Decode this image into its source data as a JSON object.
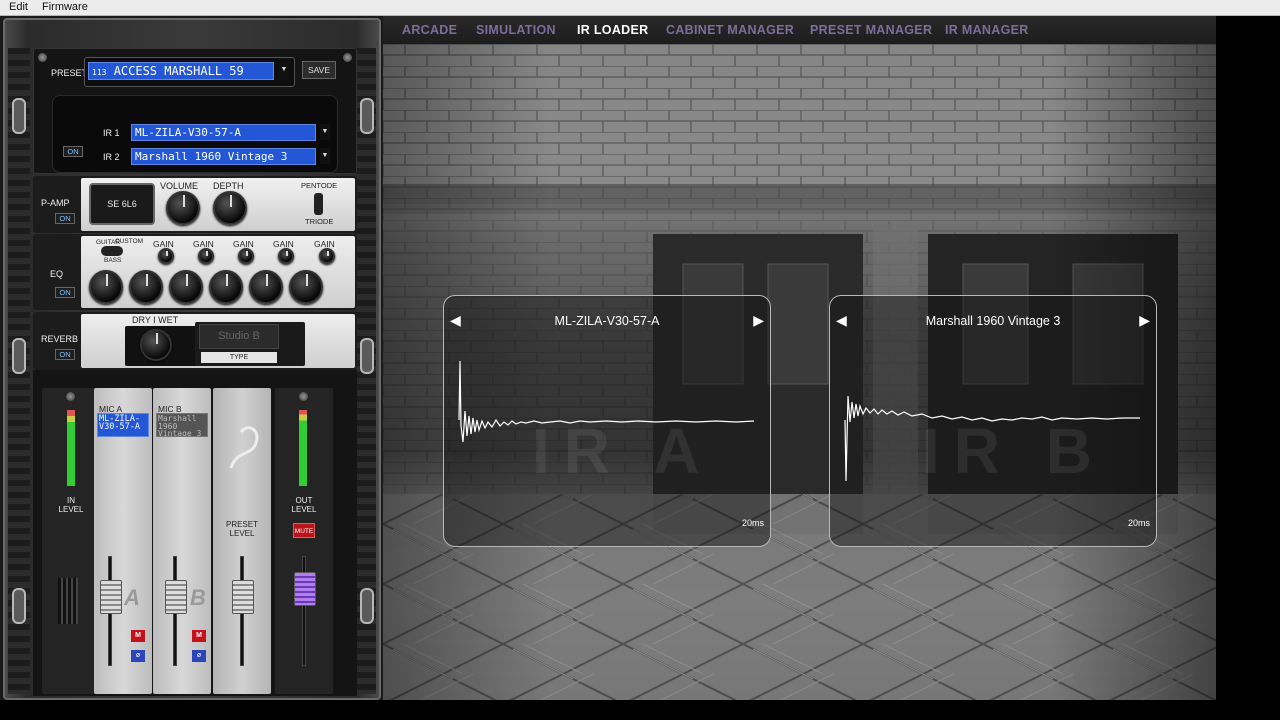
{
  "menubar": {
    "edit": "Edit",
    "firmware": "Firmware"
  },
  "tabs": [
    {
      "label": "ARCADE",
      "active": false
    },
    {
      "label": "SIMULATION",
      "active": false
    },
    {
      "label": "IR LOADER",
      "active": true
    },
    {
      "label": "CABINET MANAGER",
      "active": false
    },
    {
      "label": "PRESET MANAGER",
      "active": false
    },
    {
      "label": "IR MANAGER",
      "active": false
    }
  ],
  "colors": {
    "tab_inactive": "#7e6c9c",
    "tab_active": "#ffffff",
    "lcd_blue": "#2357d6",
    "mute_red": "#b8141b",
    "out_fader": "#8a5ad0"
  },
  "preset": {
    "label": "PRESET",
    "number": "113",
    "name": "ACCESS MARSHALL 59",
    "save": "SAVE"
  },
  "ir_section": {
    "on": "ON",
    "ir1_label": "IR 1",
    "ir1_value": "ML-ZILA-V30-57-A",
    "ir2_label": "IR 2",
    "ir2_value": "Marshall 1960 Vintage 3"
  },
  "pamp": {
    "label": "P-AMP",
    "on": "ON",
    "tube": "SE 6L6",
    "volume": "VOLUME",
    "depth": "DEPTH",
    "pentode": "PENTODE",
    "triode": "TRIODE"
  },
  "eq": {
    "label": "EQ",
    "on": "ON",
    "guitar": "GUITAR",
    "custom": "CUSTOM",
    "bass": "BASS",
    "gains": [
      "GAIN",
      "GAIN",
      "GAIN",
      "GAIN",
      "GAIN"
    ]
  },
  "reverb": {
    "label": "REVERB",
    "on": "ON",
    "dry_wet": "DRY I WET",
    "room": "Studio B",
    "type": "TYPE"
  },
  "mixer": {
    "in_level": "IN LEVEL",
    "mic_a_label": "MIC A",
    "mic_a_value": "ML-ZILA-V30-57-A",
    "mic_a_letter": "A",
    "mic_b_label": "MIC B",
    "mic_b_value": "Marshall 1960 Vintage 3",
    "mic_b_letter": "B",
    "preset_level": "PRESET LEVEL",
    "out_level": "OUT LEVEL",
    "mute": "MUTE",
    "m": "M",
    "phase": "ø"
  },
  "ir_a": {
    "title": "ML-ZILA-V30-57-A",
    "watermark": "IR A",
    "time": "20ms",
    "prev": "◀",
    "next": "▶"
  },
  "ir_b": {
    "title": "Marshall 1960 Vintage 3",
    "watermark": "IR B",
    "time": "20ms",
    "prev": "◀",
    "next": "▶"
  }
}
